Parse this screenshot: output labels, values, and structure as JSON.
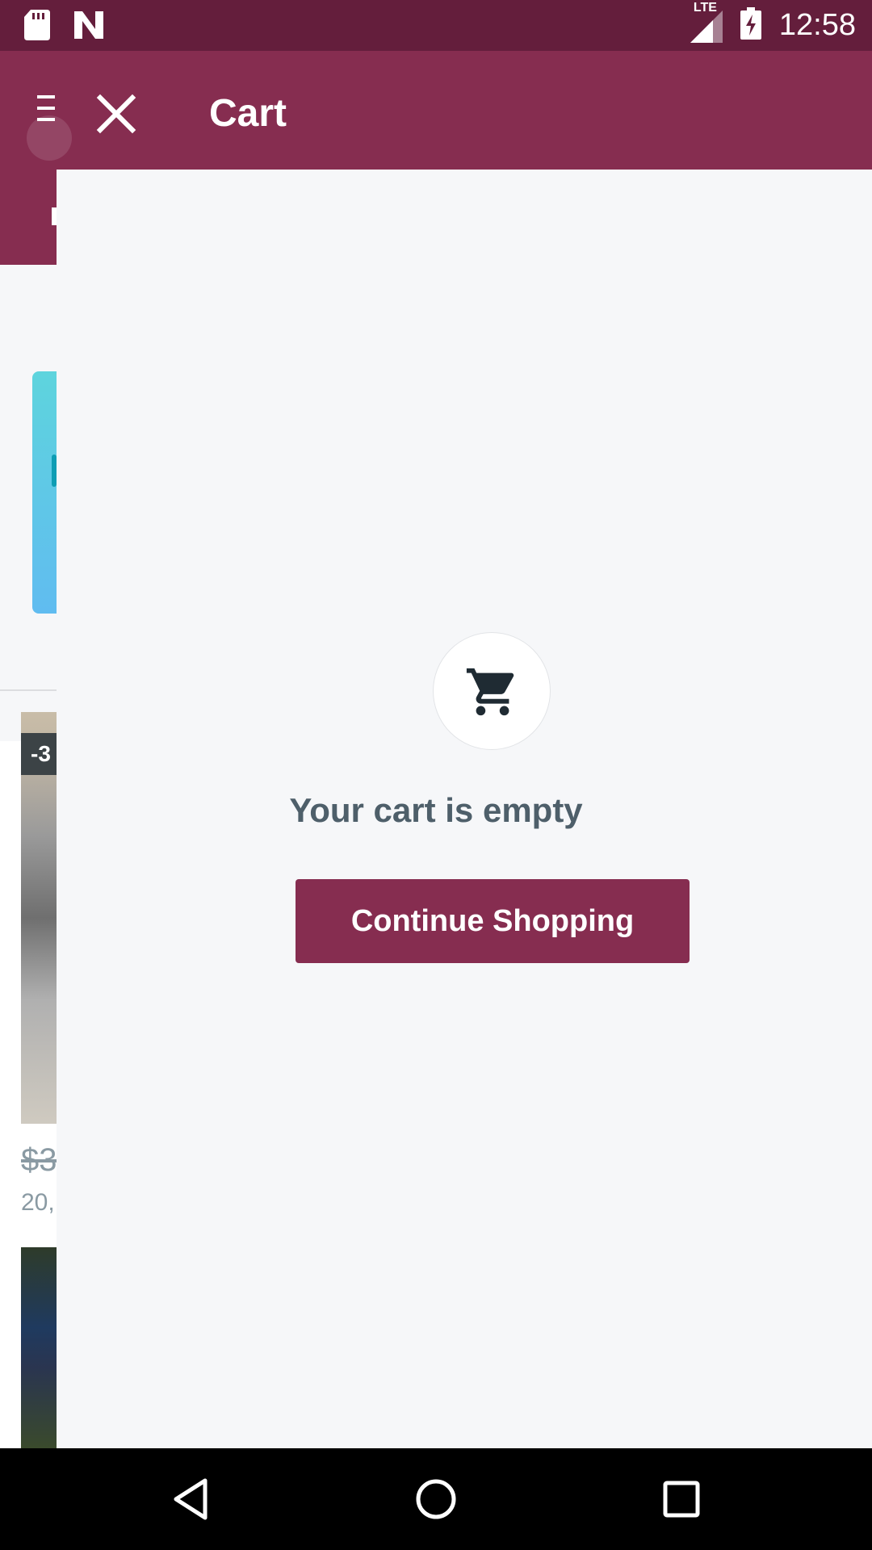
{
  "status_bar": {
    "time": "12:58",
    "network": "LTE",
    "icons": [
      "sd-card-icon",
      "n-notification-icon",
      "signal-icon",
      "battery-charging-icon"
    ]
  },
  "background_page": {
    "badge": "-3",
    "price": "$3",
    "count": "20,"
  },
  "header": {
    "title": "Cart",
    "menu_icon": "menu-icon",
    "close_icon": "close-icon"
  },
  "cart": {
    "icon": "shopping-cart-icon",
    "empty_message": "Your cart is empty",
    "continue_label": "Continue Shopping"
  },
  "nav_bar": {
    "icons": [
      "back-icon",
      "home-icon",
      "recents-icon"
    ]
  },
  "colors": {
    "brand": "#862d50",
    "status_bar": "#641e3c",
    "panel_bg": "#f6f7f9",
    "message_text": "#4e5f6a"
  }
}
